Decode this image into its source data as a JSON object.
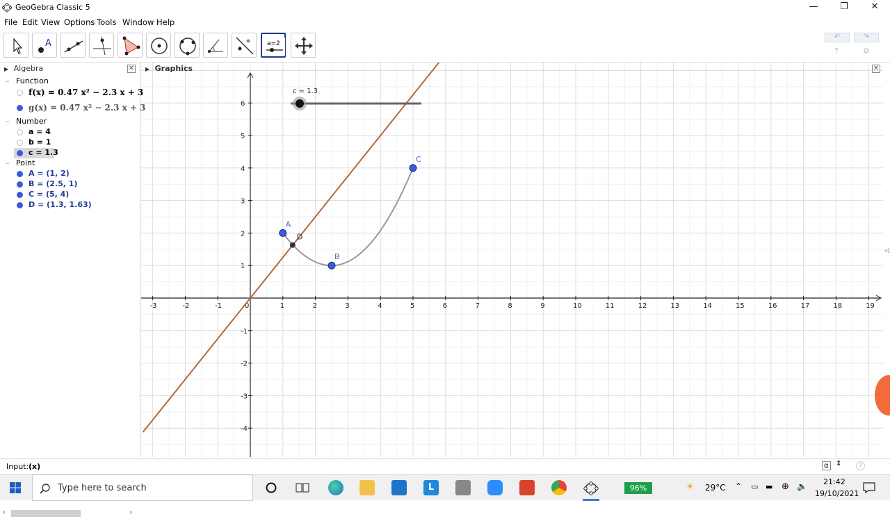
{
  "window": {
    "title": "GeoGebra Classic 5",
    "min": "—",
    "restore": "❐",
    "close": "✕"
  },
  "menu": [
    "File",
    "Edit",
    "View",
    "Options",
    "Tools",
    "Window",
    "Help"
  ],
  "toolbar": {
    "tools": [
      "move",
      "point",
      "line",
      "perpendicular",
      "polygon",
      "circle",
      "circle-3pts",
      "angle",
      "reflect",
      "slider",
      "move-graphics"
    ],
    "active": "slider",
    "slider_label": "a=2",
    "undo": "↶",
    "redo": "↷",
    "help": "?",
    "settings": "⚙"
  },
  "algebra": {
    "title": "Algebra",
    "categories": {
      "function": "Function",
      "number": "Number",
      "point": "Point"
    },
    "functions": [
      {
        "text": "f(x) = 0.47 x² − 2.3 x + 3",
        "visible": false
      },
      {
        "text": "g(x) = 0.47 x² − 2.3 x + 3",
        "visible": true
      }
    ],
    "numbers": [
      {
        "text": "a = 4",
        "visible": false
      },
      {
        "text": "b = 1",
        "visible": false
      },
      {
        "text": "c = 1.3",
        "visible": true,
        "selected": true
      }
    ],
    "points": [
      {
        "text": "A = (1, 2)",
        "visible": true
      },
      {
        "text": "B = (2.5, 1)",
        "visible": true
      },
      {
        "text": "C = (5, 4)",
        "visible": true
      },
      {
        "text": "D = (1.3, 1.63)",
        "visible": true
      }
    ]
  },
  "graphics": {
    "title": "Graphics",
    "slider_text": "c = 1.3",
    "slider": {
      "min": 0,
      "max": 10,
      "value": 1.3
    },
    "points": [
      {
        "name": "A",
        "x": 1,
        "y": 2
      },
      {
        "name": "B",
        "x": 2.5,
        "y": 1
      },
      {
        "name": "C",
        "x": 5,
        "y": 4
      },
      {
        "name": "D",
        "x": 1.3,
        "y": 1.63
      }
    ],
    "x_ticks": [
      -3,
      -2,
      -1,
      0,
      1,
      2,
      3,
      4,
      5,
      6,
      7,
      8,
      9,
      10,
      11,
      12,
      13,
      14,
      15,
      16,
      17,
      18,
      19
    ],
    "y_ticks": [
      -4,
      -3,
      -2,
      -1,
      1,
      2,
      3,
      4,
      5,
      6
    ],
    "colors": {
      "line": "#b5683d",
      "curve": "#999999",
      "point": "#3d5bd9",
      "grid": "#e6e6e6"
    }
  },
  "input": {
    "label": "Input:",
    "value": "(x)",
    "alpha": "α",
    "help": "?"
  },
  "taskbar": {
    "search_placeholder": "Type here to search",
    "battery": "96%",
    "temperature": "29°C",
    "time": "21:42",
    "date": "19/10/2021"
  }
}
